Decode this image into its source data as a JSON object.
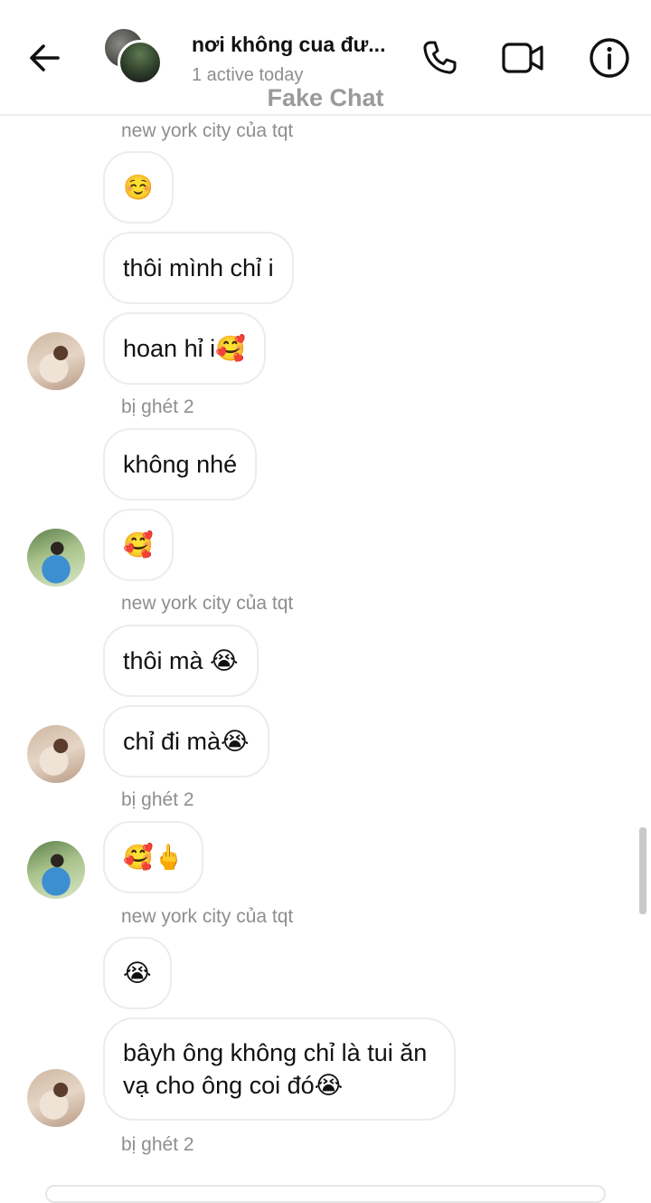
{
  "header": {
    "title": "nơi không cua đư...",
    "status": "1 active today",
    "watermark": "Fake Chat",
    "icons": {
      "back": "arrow-left-icon",
      "phone": "phone-icon",
      "video": "video-camera-icon",
      "info": "info-icon"
    }
  },
  "messages": [
    {
      "type": "sender",
      "text": "new york city của tqt"
    },
    {
      "type": "bubble",
      "text": "☺️"
    },
    {
      "type": "bubble",
      "text": "thôi mình chỉ i"
    },
    {
      "type": "bubble",
      "text": "hoan hỉ i🥰",
      "avatar": "p1"
    },
    {
      "type": "sender",
      "text": "bị ghét 2"
    },
    {
      "type": "bubble",
      "text": "không nhé"
    },
    {
      "type": "bubble",
      "text": "🥰",
      "avatar": "p2"
    },
    {
      "type": "sender",
      "text": "new york city của tqt"
    },
    {
      "type": "bubble",
      "text": "thôi mà 😭"
    },
    {
      "type": "bubble",
      "text": "chỉ đi mà😭",
      "avatar": "p1"
    },
    {
      "type": "sender",
      "text": "bị ghét 2"
    },
    {
      "type": "bubble",
      "text": "🥰🖕",
      "avatar": "p2"
    },
    {
      "type": "sender",
      "text": "new york city của tqt"
    },
    {
      "type": "bubble",
      "text": "😭"
    },
    {
      "type": "bubble",
      "text": "bâyh ông không chỉ là tui ăn vạ cho ông coi đó😭",
      "avatar": "p1"
    },
    {
      "type": "sender",
      "text": "bị ghét 2"
    }
  ]
}
